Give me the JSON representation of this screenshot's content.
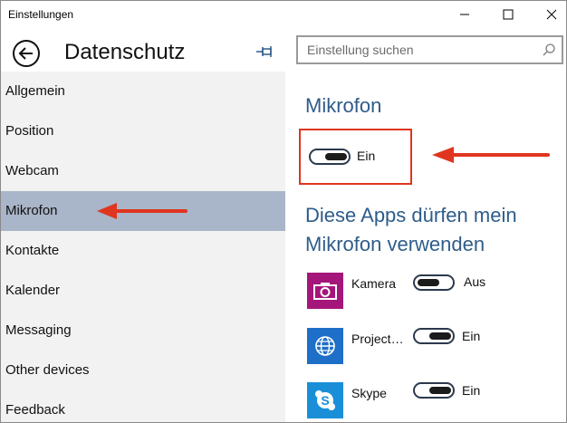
{
  "window": {
    "title": "Einstellungen"
  },
  "header": {
    "page_title": "Datenschutz"
  },
  "search": {
    "placeholder": "Einstellung suchen"
  },
  "nav": {
    "items": [
      {
        "label": "Allgemein"
      },
      {
        "label": "Position"
      },
      {
        "label": "Webcam"
      },
      {
        "label": "Mikrofon"
      },
      {
        "label": "Kontakte"
      },
      {
        "label": "Kalender"
      },
      {
        "label": "Messaging"
      },
      {
        "label": "Other devices"
      },
      {
        "label": "Feedback"
      }
    ],
    "selected": "Mikrofon"
  },
  "main": {
    "section_title": "Mikrofon",
    "mic_toggle": {
      "state": "on",
      "label": "Ein"
    },
    "apps_title_line1": "Diese Apps dürfen mein",
    "apps_title_line2": "Mikrofon verwenden",
    "apps": [
      {
        "name": "Kamera",
        "icon": "camera-icon",
        "color": "#a4167a",
        "state": "off",
        "label": "Aus"
      },
      {
        "name": "Project…",
        "icon": "globe-icon",
        "color": "#1e6fc7",
        "state": "on",
        "label": "Ein"
      },
      {
        "name": "Skype",
        "icon": "skype-icon",
        "color": "#1a8fd8",
        "state": "on",
        "label": "Ein"
      }
    ]
  },
  "colors": {
    "accent_title": "#2e5c8a",
    "selected_nav": "#a9b5c8",
    "annotation_red": "#e0351f"
  }
}
